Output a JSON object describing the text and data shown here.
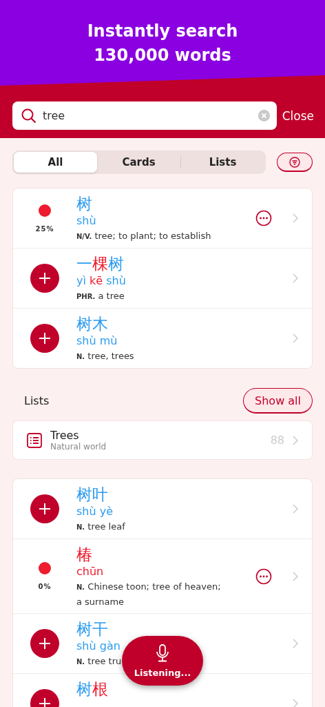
{
  "banner": {
    "lines": [
      "Instantly search",
      "130,000 words"
    ]
  },
  "search": {
    "value": "tree",
    "close": "Close"
  },
  "tabs": [
    {
      "label": "All",
      "selected": true
    },
    {
      "label": "Cards",
      "selected": false
    },
    {
      "label": "Lists",
      "selected": false
    }
  ],
  "results": [
    {
      "kind": "progress",
      "percent": "25%",
      "hanzi": [
        {
          "text": "树",
          "color": "#2d9cf0"
        }
      ],
      "pinyin": [
        {
          "text": "shù",
          "color": "#2d9cf0"
        }
      ],
      "pos": "N/V.",
      "definition": "tree; to plant; to establish"
    },
    {
      "kind": "add",
      "hanzi": [
        {
          "text": "一",
          "color": "#2d9cf0"
        },
        {
          "text": "棵",
          "color": "#ee1c2e"
        },
        {
          "text": "树",
          "color": "#2d9cf0"
        }
      ],
      "pinyin": [
        {
          "text": "yì",
          "color": "#2d9cf0"
        },
        {
          "text": "kē",
          "color": "#ee1c2e"
        },
        {
          "text": "shù",
          "color": "#2d9cf0"
        }
      ],
      "pos": "PHR.",
      "definition": "a tree"
    },
    {
      "kind": "add",
      "hanzi": [
        {
          "text": "树",
          "color": "#2d9cf0"
        },
        {
          "text": "木",
          "color": "#2d9cf0"
        }
      ],
      "pinyin": [
        {
          "text": "shù",
          "color": "#2d9cf0"
        },
        {
          "text": "mù",
          "color": "#2d9cf0"
        }
      ],
      "pos": "N.",
      "definition": "tree, trees"
    }
  ],
  "lists_section": {
    "title": "Lists",
    "show_all": "Show all",
    "items": [
      {
        "name": "Trees",
        "subtitle": "Natural world",
        "count": "88"
      }
    ]
  },
  "more_results": [
    {
      "kind": "add",
      "hanzi": [
        {
          "text": "树",
          "color": "#2d9cf0"
        },
        {
          "text": "叶",
          "color": "#2d9cf0"
        }
      ],
      "pinyin": [
        {
          "text": "shù",
          "color": "#2d9cf0"
        },
        {
          "text": "yè",
          "color": "#2d9cf0"
        }
      ],
      "pos": "N.",
      "definition": "tree leaf"
    },
    {
      "kind": "progress",
      "percent": "0%",
      "hanzi": [
        {
          "text": "椿",
          "color": "#ee1c2e"
        }
      ],
      "pinyin": [
        {
          "text": "chūn",
          "color": "#ee1c2e"
        }
      ],
      "pos": "N.",
      "definition": "Chinese toon; tree of heaven; a surname"
    },
    {
      "kind": "add",
      "hanzi": [
        {
          "text": "树",
          "color": "#2d9cf0"
        },
        {
          "text": "干",
          "color": "#2d9cf0"
        }
      ],
      "pinyin": [
        {
          "text": "shù",
          "color": "#2d9cf0"
        },
        {
          "text": "gàn",
          "color": "#2d9cf0"
        }
      ],
      "pos": "N.",
      "definition": "tree tru"
    },
    {
      "kind": "add",
      "hanzi": [
        {
          "text": "树",
          "color": "#2d9cf0"
        },
        {
          "text": "根",
          "color": "#ee1c2e"
        }
      ]
    }
  ],
  "voice": {
    "label": "Listening..."
  }
}
